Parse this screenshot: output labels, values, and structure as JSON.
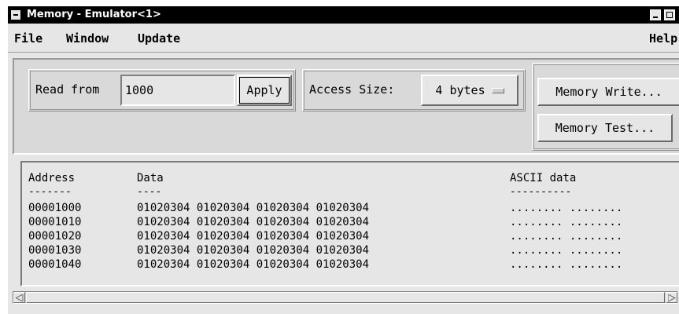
{
  "window": {
    "title": "Memory - Emulator<1>"
  },
  "menubar": {
    "items": [
      "File",
      "Window",
      "Update"
    ],
    "help": "Help"
  },
  "controls": {
    "read_from_label": "Read from",
    "read_from_value": "1000",
    "apply_label": "Apply",
    "access_size_label": "Access Size:",
    "access_size_value": "4 bytes",
    "memory_write_label": "Memory Write...",
    "memory_test_label": "Memory Test..."
  },
  "memory": {
    "headers": {
      "address": "Address",
      "data": "Data",
      "ascii": "ASCII data"
    },
    "underlines": {
      "address": "-------",
      "data": "----",
      "ascii": "----------"
    },
    "rows": [
      {
        "address": "00001000",
        "data": "01020304 01020304 01020304 01020304",
        "ascii": "........ ........"
      },
      {
        "address": "00001010",
        "data": "01020304 01020304 01020304 01020304",
        "ascii": "........ ........"
      },
      {
        "address": "00001020",
        "data": "01020304 01020304 01020304 01020304",
        "ascii": "........ ........"
      },
      {
        "address": "00001030",
        "data": "01020304 01020304 01020304 01020304",
        "ascii": "........ ........"
      },
      {
        "address": "00001040",
        "data": "01020304 01020304 01020304 01020304",
        "ascii": "........ ........"
      }
    ]
  },
  "icons": {
    "window_menu": "window-menu-icon",
    "minimize": "minimize-icon",
    "maximize": "maximize-icon",
    "scroll_left": "arrow-left-icon",
    "scroll_right": "arrow-right-icon",
    "option_menu": "option-menu-indicator-icon"
  }
}
